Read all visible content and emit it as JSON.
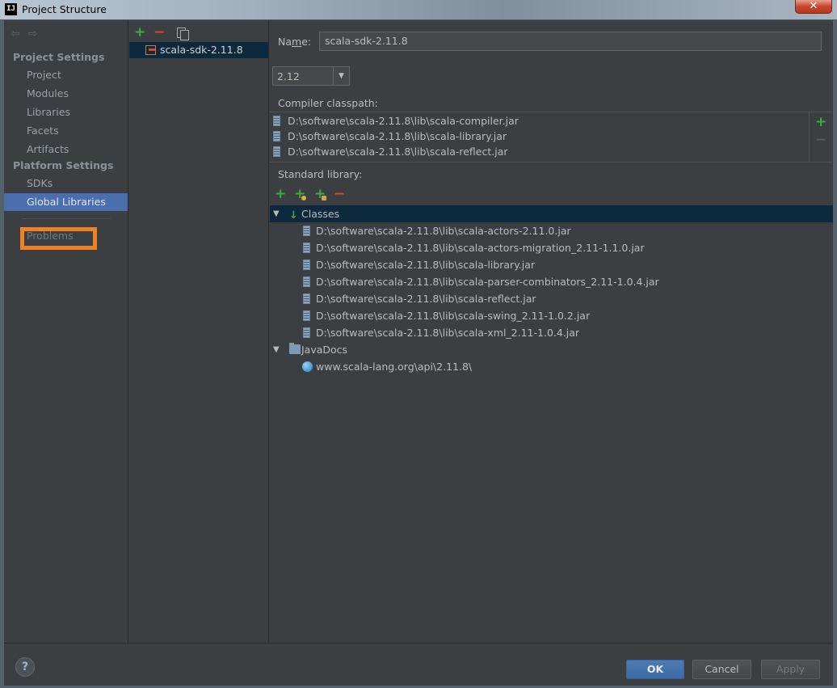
{
  "window": {
    "title": "Project Structure",
    "app_icon": "IJ",
    "close_glyph": "✕"
  },
  "nav": {
    "back_arrow": "⇦",
    "forward_arrow": "⇨",
    "project_settings_header": "Project Settings",
    "project_items": [
      "Project",
      "Modules",
      "Libraries",
      "Facets",
      "Artifacts"
    ],
    "platform_settings_header": "Platform Settings",
    "platform_items": [
      "SDKs",
      "Global Libraries"
    ],
    "selected": "Global Libraries",
    "problems_label": "Problems",
    "highlight_color": "#f08223"
  },
  "libraries": {
    "add_glyph": "+",
    "remove_glyph": "−",
    "items": [
      "scala-sdk-2.11.8"
    ]
  },
  "detail": {
    "name_label_prefix": "Na",
    "name_label_underlined": "m",
    "name_label_suffix": "e:",
    "name_value": "scala-sdk-2.11.8",
    "version_value": "2.12",
    "version_arrow": "▼",
    "compiler_classpath_label": "Compiler classpath:",
    "compiler_classpath": [
      "D:\\software\\scala-2.11.8\\lib\\scala-compiler.jar",
      "D:\\software\\scala-2.11.8\\lib\\scala-library.jar",
      "D:\\software\\scala-2.11.8\\lib\\scala-reflect.jar"
    ],
    "cp_add_glyph": "+",
    "cp_remove_glyph": "−",
    "standard_library_label": "Standard library:",
    "std_add_glyph": "+",
    "std_remove_glyph": "−",
    "tree": {
      "expand_glyph": "▼",
      "classes_label": "Classes",
      "classes_icon_glyph": "↓",
      "classes": [
        "D:\\software\\scala-2.11.8\\lib\\scala-actors-2.11.0.jar",
        "D:\\software\\scala-2.11.8\\lib\\scala-actors-migration_2.11-1.1.0.jar",
        "D:\\software\\scala-2.11.8\\lib\\scala-library.jar",
        "D:\\software\\scala-2.11.8\\lib\\scala-parser-combinators_2.11-1.0.4.jar",
        "D:\\software\\scala-2.11.8\\lib\\scala-reflect.jar",
        "D:\\software\\scala-2.11.8\\lib\\scala-swing_2.11-1.0.2.jar",
        "D:\\software\\scala-2.11.8\\lib\\scala-xml_2.11-1.0.4.jar"
      ],
      "javadocs_label": "JavaDocs",
      "javadocs": [
        "www.scala-lang.org\\api\\2.11.8\\"
      ]
    }
  },
  "footer": {
    "help_glyph": "?",
    "ok_label": "OK",
    "cancel_label": "Cancel",
    "apply_label": "Apply"
  }
}
